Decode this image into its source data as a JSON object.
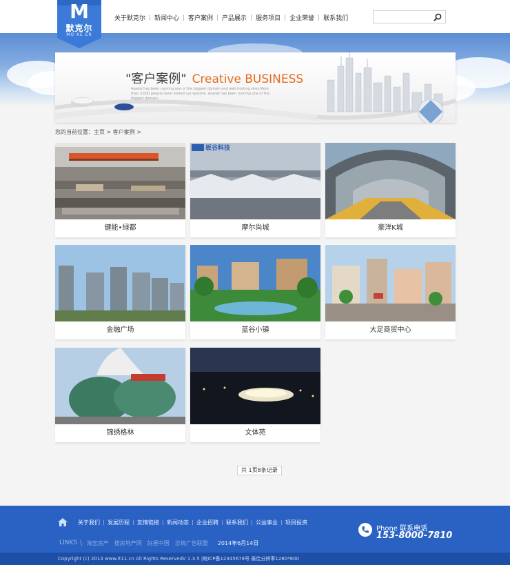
{
  "logo": {
    "letter": "M",
    "name": "默克尔",
    "subtitle": "MO KE ER"
  },
  "nav": {
    "items": [
      "关于默克尔",
      "新闻中心",
      "客户案例",
      "产品展示",
      "服务项目",
      "企业荣誉",
      "联系我们"
    ]
  },
  "search": {
    "placeholder": ""
  },
  "banner": {
    "title_cn": "\"客户案例\"",
    "title_en": "Creative BUSINESS",
    "desc": "Asadal has been running one of the biggest domain and web hosting sites.More than 3,000 people have visited our website. Asadal has been running one of the biggest domain."
  },
  "breadcrumb": "您的当前位置：主页 > 客户案例 >",
  "cases": [
    {
      "label": "健能•绿都"
    },
    {
      "label": "摩尔尚城",
      "logo_text": "板谷科技"
    },
    {
      "label": "豪洋K城"
    },
    {
      "label": "金融广场"
    },
    {
      "label": "蓝谷小镇"
    },
    {
      "label": "大足商贸中心"
    },
    {
      "label": "锦绣格林"
    },
    {
      "label": "文体苑"
    }
  ],
  "pagination": "共 1页8条记录",
  "footer": {
    "nav": [
      "关于我们",
      "发展历程",
      "友情链接",
      "新闻动态",
      "企业招聘",
      "联系我们",
      "公益事业",
      "项目投资"
    ],
    "links_title": "LINKS",
    "links": [
      "淘宝房产",
      "搜房地产网",
      "好屋中国",
      "正统广告联盟"
    ],
    "date": "2014年6月14日",
    "phone_label": "Phone 联系电话",
    "phone_number": "153-8000-7810",
    "copyright": "Copyright (c) 2013 www.it11.cn All Rights ReservedV 1.3.5 |皖ICP备12345678号 最佳分辨率1280*800"
  },
  "colors": {
    "brand_blue": "#2a62c4",
    "accent_orange": "#e36d1c",
    "logo_blue": "#3b7ad9"
  }
}
